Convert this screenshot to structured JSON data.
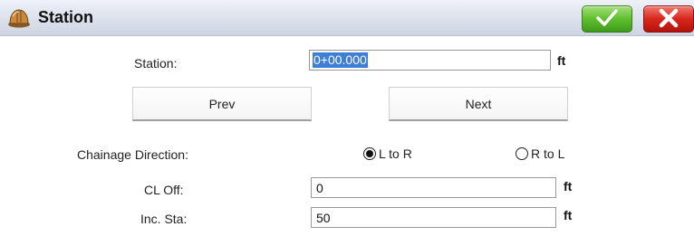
{
  "window": {
    "title": "Station",
    "app_icon": "hard-hat-icon",
    "ok_icon": "checkmark-icon",
    "cancel_icon": "x-icon"
  },
  "form": {
    "station": {
      "label": "Station:",
      "value": "0+00.000",
      "unit": "ft"
    },
    "prev_label": "Prev",
    "next_label": "Next",
    "chainage": {
      "label": "Chainage Direction:",
      "options": [
        {
          "label": "L to R",
          "selected": true
        },
        {
          "label": "R to L",
          "selected": false
        }
      ]
    },
    "cl_off": {
      "label": "CL Off:",
      "value": "0",
      "unit": "ft"
    },
    "inc_sta": {
      "label": "Inc. Sta:",
      "value": "50",
      "unit": "ft"
    }
  },
  "colors": {
    "ok_green": "#5fbf2e",
    "cancel_red": "#d8261c",
    "selection_blue": "#3d7fd6"
  }
}
